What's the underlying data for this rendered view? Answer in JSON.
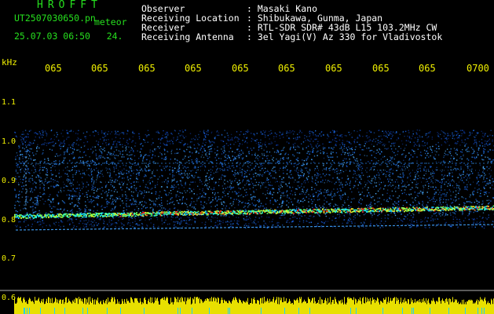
{
  "header": {
    "title": "HROFFT",
    "filename": "UT2507030650.pn",
    "type_label": "meteor",
    "timestamp": "25.07.03 06:50   24.",
    "rows": [
      {
        "label": "Observer",
        "value": ": Masaki Kano"
      },
      {
        "label": "Receiving Location",
        "value": ": Shibukawa, Gunma, Japan"
      },
      {
        "label": "Receiver",
        "value": ": RTL-SDR SDR# 43dB L15 103.2MHz CW"
      },
      {
        "label": "Receiving Antenna",
        "value": ": 3el Yagi(V) Az 330 for Vladivostok"
      }
    ]
  },
  "axis": {
    "unit": "kHz",
    "time_ticks": [
      "065",
      "065",
      "065",
      "065",
      "065",
      "065",
      "065",
      "065",
      "065",
      "0700"
    ],
    "freq_ticks": [
      "1.1",
      "1.0",
      "0.9",
      "0.8",
      "0.7",
      "0.6"
    ]
  },
  "colors": {
    "text": "#ffffff",
    "accent_green": "#26e01e",
    "accent_yellow": "#f0f000",
    "background": "#000000"
  }
}
